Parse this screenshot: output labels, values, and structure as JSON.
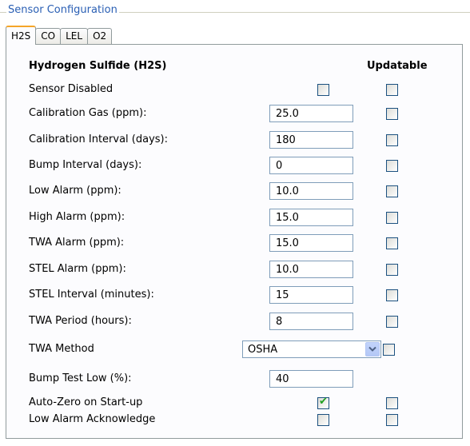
{
  "group": {
    "title": "Sensor Configuration"
  },
  "tabs": [
    {
      "label": "H2S",
      "active": true
    },
    {
      "label": "CO",
      "active": false
    },
    {
      "label": "LEL",
      "active": false
    },
    {
      "label": "O2",
      "active": false
    }
  ],
  "panel": {
    "heading": "Hydrogen Sulfide (H2S)",
    "updatable_header": "Updatable",
    "sensor_disabled": {
      "label": "Sensor Disabled",
      "checked": false,
      "updatable": false
    },
    "calibration_gas": {
      "label": "Calibration Gas (ppm):",
      "value": "25.0",
      "updatable": false
    },
    "calibration_interval": {
      "label": "Calibration Interval (days):",
      "value": "180",
      "updatable": false
    },
    "bump_interval": {
      "label": "Bump Interval (days):",
      "value": "0",
      "updatable": false
    },
    "low_alarm": {
      "label": "Low Alarm (ppm):",
      "value": "10.0",
      "updatable": false
    },
    "high_alarm": {
      "label": "High Alarm (ppm):",
      "value": "15.0",
      "updatable": false
    },
    "twa_alarm": {
      "label": "TWA Alarm (ppm):",
      "value": "15.0",
      "updatable": false
    },
    "stel_alarm": {
      "label": "STEL Alarm (ppm):",
      "value": "10.0",
      "updatable": false
    },
    "stel_interval": {
      "label": "STEL Interval (minutes):",
      "value": "15",
      "updatable": false
    },
    "twa_period": {
      "label": "TWA Period (hours):",
      "value": "8",
      "updatable": false
    },
    "twa_method": {
      "label": "TWA Method",
      "value": "OSHA",
      "updatable": false
    },
    "bump_test_low": {
      "label": "Bump Test Low (%):",
      "value": "40"
    },
    "auto_zero": {
      "label": "Auto-Zero on Start-up",
      "checked": true,
      "updatable": false
    },
    "low_alarm_ack": {
      "label": "Low Alarm Acknowledge",
      "checked": false,
      "updatable": false
    }
  },
  "colors": {
    "group_title": "#2a5fb4",
    "active_tab_accent": "#f5a528",
    "checkmark": "#21a121",
    "input_border": "#7f9db9"
  }
}
